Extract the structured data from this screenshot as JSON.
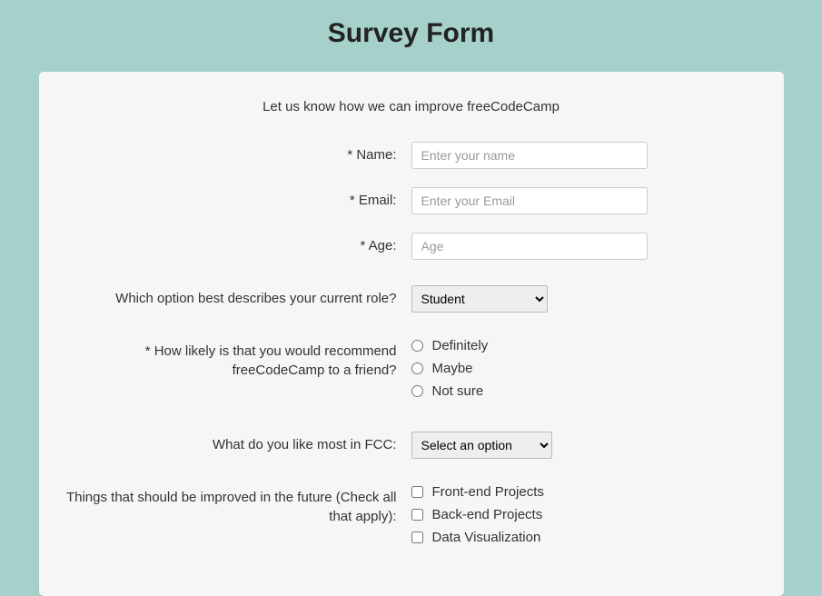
{
  "title": "Survey Form",
  "intro": "Let us know how we can improve freeCodeCamp",
  "fields": {
    "name": {
      "label": "* Name:",
      "placeholder": "Enter your name",
      "value": ""
    },
    "email": {
      "label": "* Email:",
      "placeholder": "Enter your Email",
      "value": ""
    },
    "age": {
      "label": "* Age:",
      "placeholder": "Age",
      "value": ""
    },
    "role": {
      "label": "Which option best describes your current role?",
      "selected": "Student"
    },
    "recommend": {
      "label": "* How likely is that you would recommend freeCodeCamp to a friend?",
      "options": {
        "definitely": "Definitely",
        "maybe": "Maybe",
        "notsure": "Not sure"
      }
    },
    "like": {
      "label": "What do you like most in FCC:",
      "selected": "Select an option"
    },
    "improve": {
      "label": "Things that should be improved in the future (Check all that apply):",
      "options": {
        "front": "Front-end Projects",
        "back": "Back-end Projects",
        "dataviz": "Data Visualization"
      }
    }
  }
}
